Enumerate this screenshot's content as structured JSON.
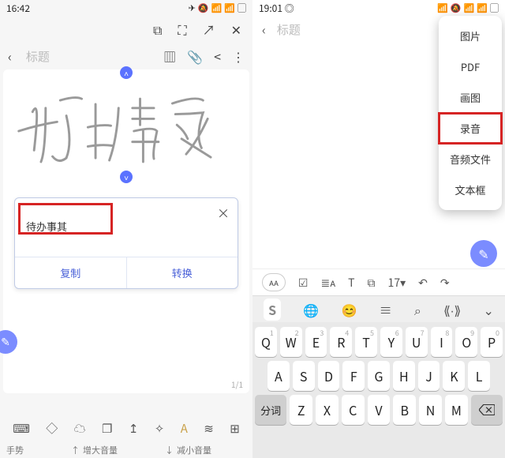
{
  "left": {
    "status": {
      "time": "16:42",
      "icons": [
        "📷",
        "📶",
        "🔕",
        "📶",
        "📶",
        "▢"
      ]
    },
    "bar1_icons": [
      "crop-icon",
      "expand-icon",
      "open-icon",
      "close-icon"
    ],
    "bar2": {
      "back": "‹",
      "placeholder": "标题",
      "icons": [
        "panel-icon",
        "attach-icon",
        "share-icon",
        "more-icon"
      ]
    },
    "blue_top": "˄",
    "blue_bot": "˅",
    "recog": {
      "text": "待办事其",
      "close": "×",
      "copy": "复制",
      "convert": "转换"
    },
    "page": "1/1",
    "bottom_icons": [
      "keyboard-icon",
      "eraser-icon",
      "cloud-icon",
      "layers-icon",
      "align-icon",
      "wand-icon",
      "pen-style-icon",
      "flow-icon",
      "grid-icon"
    ],
    "gesture_label": "手势",
    "vol_up": "增大音量",
    "vol_down": "减小音量"
  },
  "right": {
    "status": {
      "time": "19:01",
      "weibo": "⦿",
      "icons": [
        "📶",
        "🔕",
        "📶",
        "📶",
        "▢"
      ]
    },
    "top": {
      "back": "‹",
      "placeholder": "标题",
      "panel": "▥",
      "more": "⋮"
    },
    "menu": [
      "图片",
      "PDF",
      "画图",
      "录音",
      "音频文件",
      "文本框"
    ],
    "menu_highlight_index": 3,
    "toolbar": {
      "pill": "ᴀᴀ",
      "items": [
        "☑",
        "≣ᴀ",
        "T",
        "⧉",
        "17▾",
        "↶",
        "↷"
      ]
    },
    "suggest": {
      "logo": "S",
      "items": [
        "🌐",
        "😊",
        "≡",
        "⌕",
        "⟪∙⟫",
        "⌄"
      ]
    },
    "kbd": {
      "row1": [
        [
          "1",
          "Q"
        ],
        [
          "2",
          "W"
        ],
        [
          "3",
          "E"
        ],
        [
          "4",
          "R"
        ],
        [
          "5",
          "T"
        ],
        [
          "6",
          "Y"
        ],
        [
          "7",
          "U"
        ],
        [
          "8",
          "I"
        ],
        [
          "9",
          "O"
        ],
        [
          "0",
          "P"
        ]
      ],
      "row2": [
        [
          "",
          "A"
        ],
        [
          "",
          "S"
        ],
        [
          "",
          "D"
        ],
        [
          "",
          "F"
        ],
        [
          "",
          "G"
        ],
        [
          "",
          "H"
        ],
        [
          "",
          "J"
        ],
        [
          "",
          "K"
        ],
        [
          "",
          "L"
        ]
      ],
      "row3_fn_left": "分词",
      "row3": [
        [
          "",
          "Z"
        ],
        [
          "",
          "X"
        ],
        [
          "",
          "C"
        ],
        [
          "",
          "V"
        ],
        [
          "",
          "B"
        ],
        [
          "",
          "N"
        ],
        [
          "",
          "M"
        ]
      ]
    }
  }
}
